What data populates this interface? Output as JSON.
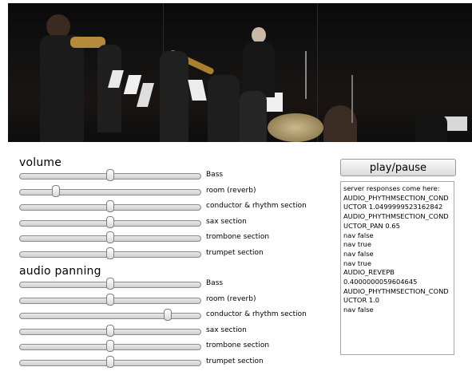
{
  "volume": {
    "title": "volume",
    "sliders": [
      {
        "label": "Bass",
        "level": 0.5
      },
      {
        "label": "room (reverb)",
        "level": 0.2
      },
      {
        "label": "conductor & rhythm section",
        "level": 0.5
      },
      {
        "label": "sax section",
        "level": 0.5
      },
      {
        "label": "trombone section",
        "level": 0.5
      },
      {
        "label": "trumpet section",
        "level": 0.5
      }
    ]
  },
  "panning": {
    "title": "audio panning",
    "sliders": [
      {
        "label": "Bass",
        "level": 0.5
      },
      {
        "label": "room (reverb)",
        "level": 0.5
      },
      {
        "label": "conductor & rhythm section",
        "level": 0.82
      },
      {
        "label": "sax section",
        "level": 0.5
      },
      {
        "label": "trombone section",
        "level": 0.5
      },
      {
        "label": "trumpet section",
        "level": 0.5
      }
    ]
  },
  "controls": {
    "play_label": "play/pause"
  },
  "log": {
    "lines": [
      "server responses come here:",
      "AUDIO_PHYTHMSECTION_COND",
      "UCTOR 1.0499999523162842",
      "AUDIO_PHYTHMSECTION_COND",
      "UCTOR_PAN 0.65",
      "nav false",
      "nav true",
      "nav false",
      "nav true",
      "AUDIO_REVEPB",
      "0.4000000059604645",
      "AUDIO_PHYTHMSECTION_COND",
      "UCTOR 1.0",
      "nav false"
    ]
  },
  "video": {
    "icon": "concert-video-frame"
  }
}
